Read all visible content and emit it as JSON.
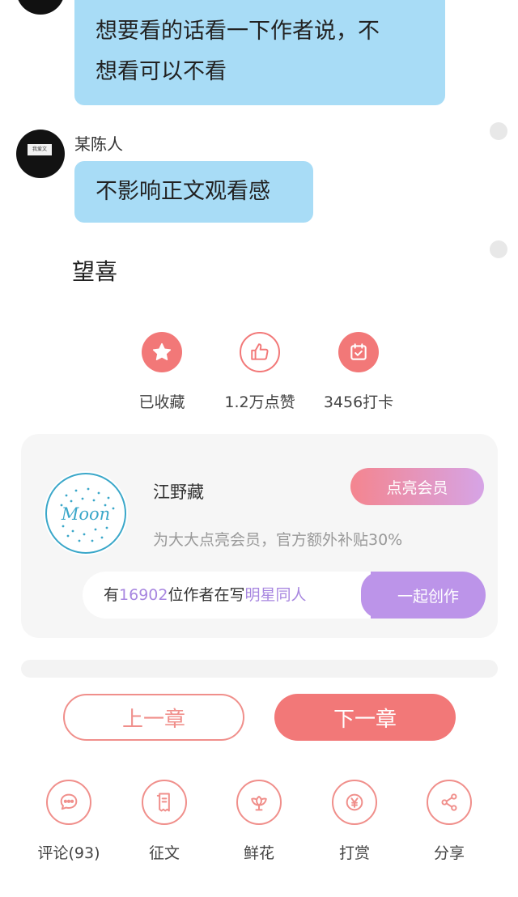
{
  "messages": [
    {
      "text_line1": "想要看的话看一下作者说，不",
      "text_line2": "想看可以不看"
    },
    {
      "author": "某陈人",
      "avatar_text": "我爱文",
      "text": "不影响正文观看感"
    }
  ],
  "plain_text": "望喜",
  "stats": [
    {
      "icon": "star-icon",
      "label": "已收藏"
    },
    {
      "icon": "thumbs-up-icon",
      "label": "1.2万点赞"
    },
    {
      "icon": "calendar-check-icon",
      "label": "3456打卡"
    }
  ],
  "author_card": {
    "logo_text": "Moon",
    "name": "江野藏",
    "member_button": "点亮会员",
    "subsidy_text": "为大大点亮会员，官方额外补贴30%",
    "writers_prefix": "有",
    "writers_count": "16902",
    "writers_middle": "位作者在写",
    "writers_topic": "明星同人",
    "write_button": "一起创作"
  },
  "navigation": {
    "prev": "上一章",
    "next": "下一章"
  },
  "actions": [
    {
      "icon": "comment-icon",
      "label": "评论(93)"
    },
    {
      "icon": "essay-icon",
      "label": "征文"
    },
    {
      "icon": "flower-icon",
      "label": "鲜花"
    },
    {
      "icon": "yen-icon",
      "label": "打赏"
    },
    {
      "icon": "share-icon",
      "label": "分享"
    }
  ],
  "colors": {
    "accent": "#f27878",
    "bubble": "#a8dcf6",
    "purple": "#bc94e9"
  }
}
